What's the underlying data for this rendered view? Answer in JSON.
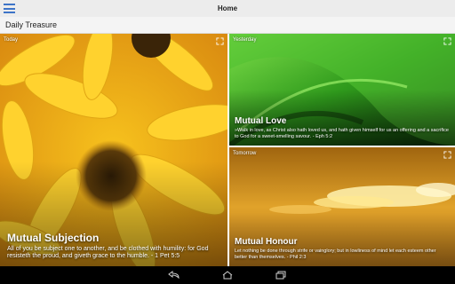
{
  "status_bar": {
    "title": "Home",
    "menu_icon": "hamburger-menu-icon"
  },
  "app_bar": {
    "title": "Daily Treasure"
  },
  "cards": {
    "today": {
      "label": "Today",
      "title": "Mutual Subjection",
      "text": "All of you be subject one to another, and be clothed with humility: for God resisteth the proud, and giveth grace to the humble. - 1 Pet 5:5",
      "image": "yellow-sunflower-image"
    },
    "yesterday": {
      "label": "Yesterday",
      "title": "Mutual Love",
      "text": "»Walk in love, as Christ also hath loved us, and hath given himself for us an offering and a sacrifice to God for a sweet-smelling savour. - Eph 5:2",
      "image": "green-leaf-image"
    },
    "tomorrow": {
      "label": "Tomorrow",
      "title": "Mutual Honour",
      "text": "Let nothing be done through strife or vainglory; but in lowliness of mind let each esteem other better than themselves. - Phil 2:3",
      "image": "golden-sky-clouds-image"
    }
  },
  "nav_bar": {
    "icons": [
      "back-icon",
      "home-icon",
      "recent-apps-icon"
    ]
  }
}
